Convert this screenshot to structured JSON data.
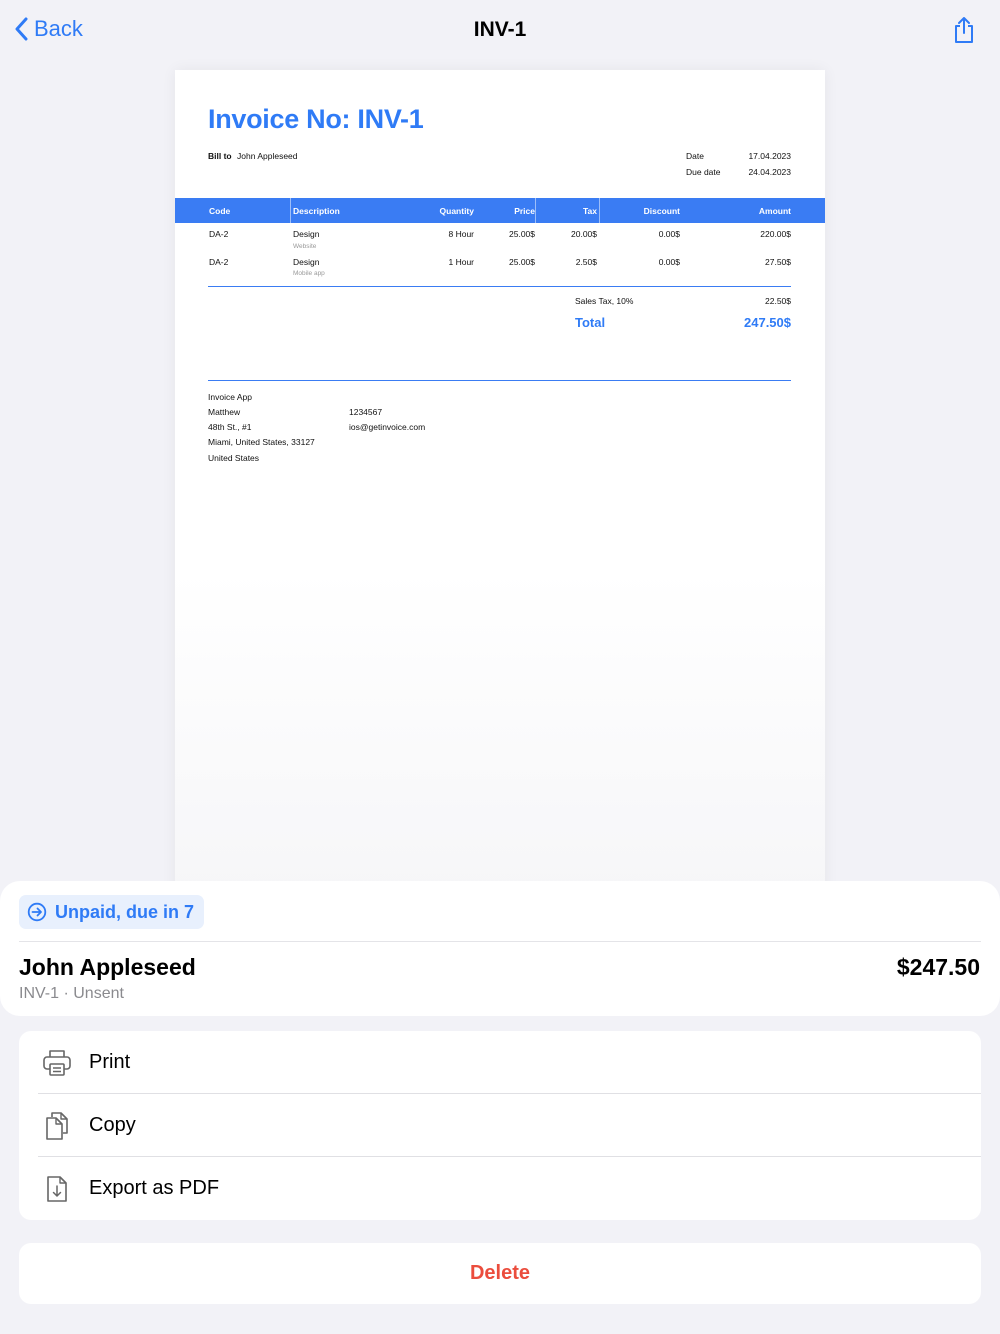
{
  "nav": {
    "back_label": "Back",
    "title": "INV-1"
  },
  "invoice": {
    "title": "Invoice No: INV-1",
    "bill_to_label": "Bill to",
    "bill_to_name": "John Appleseed",
    "date_label": "Date",
    "date_value": "17.04.2023",
    "due_label": "Due date",
    "due_value": "24.04.2023",
    "columns": [
      "Code",
      "Description",
      "Quantity",
      "Price",
      "Tax",
      "Discount",
      "Amount"
    ],
    "rows": [
      {
        "code": "DA-2",
        "description": "Design",
        "note": "Website",
        "quantity": "8 Hour",
        "price": "25.00$",
        "tax": "20.00$",
        "discount": "0.00$",
        "amount": "220.00$"
      },
      {
        "code": "DA-2",
        "description": "Design",
        "note": "Mobile app",
        "quantity": "1 Hour",
        "price": "25.00$",
        "tax": "2.50$",
        "discount": "0.00$",
        "amount": "27.50$"
      }
    ],
    "sales_tax_label": "Sales Tax, 10%",
    "sales_tax_value": "22.50$",
    "total_label": "Total",
    "total_value": "247.50$",
    "footer": {
      "company": "Invoice App",
      "name": "Matthew",
      "street": "48th St., #1",
      "city": "Miami, United States, 33127",
      "country": "United States",
      "phone": "1234567",
      "email": "ios@getinvoice.com"
    }
  },
  "sheet": {
    "status": "Unpaid, due in 7",
    "client": "John Appleseed",
    "amount": "$247.50",
    "subtitle": "INV-1 · Unsent"
  },
  "actions": {
    "print": "Print",
    "copy": "Copy",
    "export": "Export as PDF"
  },
  "delete_label": "Delete",
  "colors": {
    "accent": "#2f7bf6",
    "table_header": "#3a7cf3",
    "destructive": "#eb4d3d"
  }
}
